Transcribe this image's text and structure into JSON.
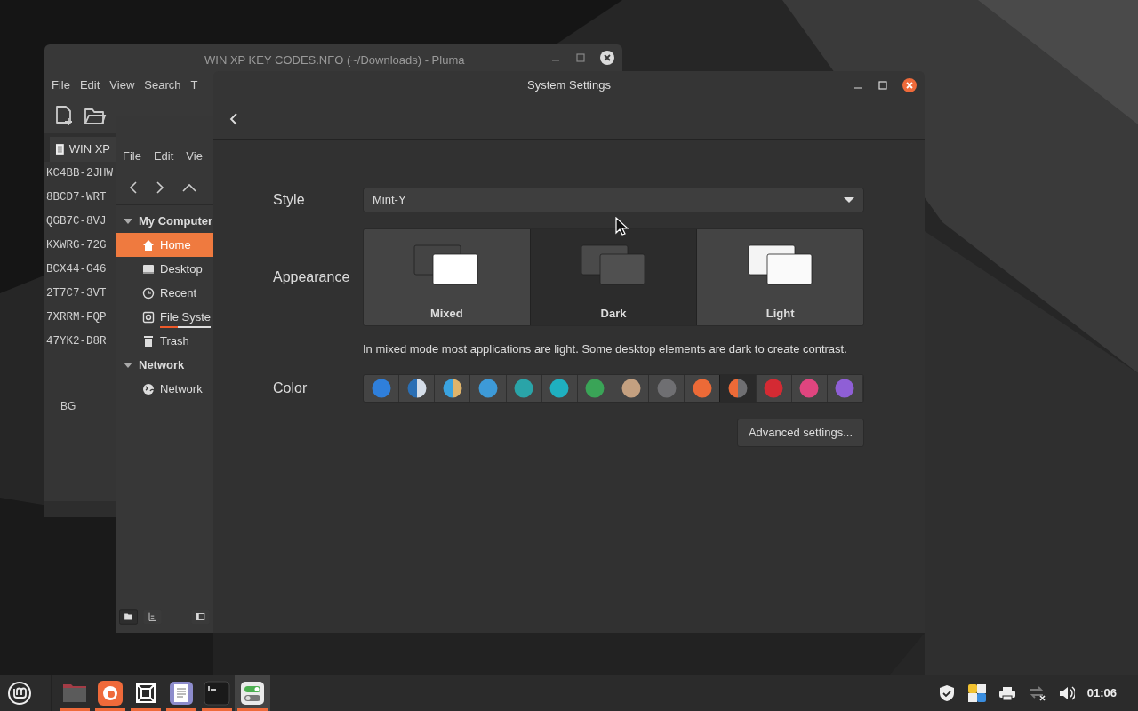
{
  "pluma": {
    "title": "WIN XP KEY CODES.NFO (~/Downloads) - Pluma",
    "menu": [
      "File",
      "Edit",
      "View",
      "Search",
      "T"
    ],
    "tab": "WIN XP",
    "lines": [
      "KC4BB-2JHW",
      "8BCD7-WRT",
      "QGB7C-8VJ",
      "KXWRG-72G",
      "BCX44-G46",
      "2T7C7-3VT",
      "7XRRM-FQP",
      "47YK2-D8R"
    ],
    "footer": "BG"
  },
  "nemo": {
    "menu": [
      "File",
      "Edit",
      "Vie"
    ],
    "sections": [
      {
        "label": "My Computer",
        "expanded": true,
        "items": [
          {
            "label": "Home",
            "selected": true
          },
          {
            "label": "Desktop",
            "selected": false
          },
          {
            "label": "Recent",
            "selected": false
          },
          {
            "label": "File Syste",
            "selected": false,
            "level": 0.35
          },
          {
            "label": "Trash",
            "selected": false
          }
        ]
      },
      {
        "label": "Network",
        "expanded": true,
        "items": [
          {
            "label": "Network",
            "selected": false
          }
        ]
      }
    ]
  },
  "settings": {
    "title": "System Settings",
    "style_label": "Style",
    "style_value": "Mint-Y",
    "appearance_label": "Appearance",
    "appearances": [
      {
        "label": "Mixed",
        "kind": "mixed",
        "selected": false
      },
      {
        "label": "Dark",
        "kind": "dark",
        "selected": true
      },
      {
        "label": "Light",
        "kind": "light",
        "selected": false
      }
    ],
    "description": "In mixed mode most applications are light. Some desktop elements are dark to create contrast.",
    "color_label": "Color",
    "colors": [
      {
        "color": "#2f7fdb",
        "selected": false
      },
      {
        "halves": [
          {
            "color": "#2a6fb5"
          },
          {
            "color": "#d4dde8"
          }
        ],
        "selected": false
      },
      {
        "halves": [
          {
            "color": "#3aa3e0"
          },
          {
            "color": "#e0b46a"
          }
        ],
        "selected": false
      },
      {
        "color": "#3d9ad8",
        "selected": false
      },
      {
        "color": "#2aa4a8",
        "selected": false
      },
      {
        "color": "#1fb0c0",
        "selected": false
      },
      {
        "color": "#3aa457",
        "selected": false
      },
      {
        "color": "#c4a080",
        "selected": false
      },
      {
        "color": "#6f6f72",
        "selected": false
      },
      {
        "color": "#ec6a37",
        "selected": false
      },
      {
        "halves": [
          {
            "color": "#ec6a37"
          },
          {
            "color": "#6f6f72"
          }
        ],
        "selected": true
      },
      {
        "color": "#d42a33",
        "selected": false
      },
      {
        "color": "#e0457f",
        "selected": false
      },
      {
        "color": "#8f5fd6",
        "selected": false
      }
    ],
    "advanced_button": "Advanced settings..."
  },
  "taskbar": {
    "apps": [
      {
        "kind": "files",
        "running": true
      },
      {
        "kind": "firefox",
        "running": true
      },
      {
        "kind": "screenshot",
        "running": true
      },
      {
        "kind": "editor",
        "running": true
      },
      {
        "kind": "terminal",
        "running": true
      },
      {
        "kind": "settings",
        "running": true
      }
    ],
    "clock": "01:06"
  }
}
